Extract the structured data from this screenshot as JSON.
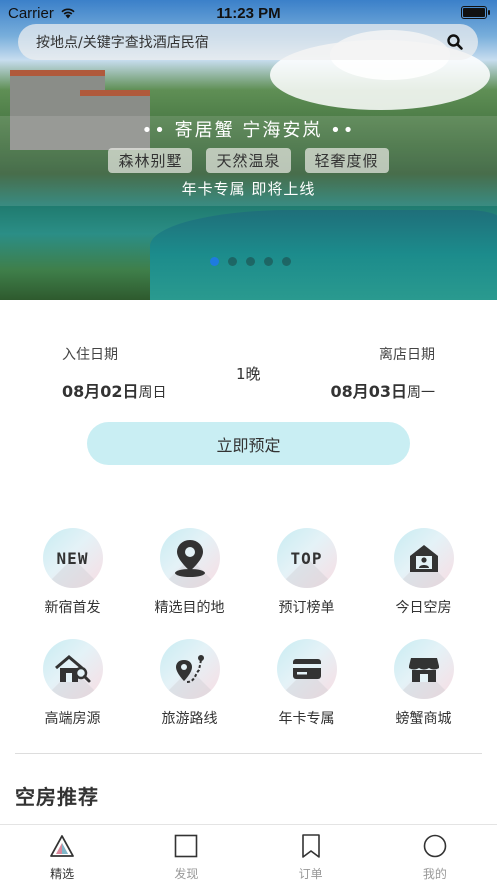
{
  "status_bar": {
    "carrier": "Carrier",
    "time": "11:23 PM"
  },
  "search": {
    "placeholder": "按地点/关键字查找酒店民宿",
    "icon": "search-icon"
  },
  "banner": {
    "title": "•• 寄居蟹 宁海安岚 ••",
    "tags": [
      "森林别墅",
      "天然温泉",
      "轻奢度假"
    ],
    "subtitle": "年卡专属  即将上线",
    "slide_count": 5,
    "active_slide": 0
  },
  "booking": {
    "checkin_label": "入住日期",
    "checkin_date": "08月02日",
    "checkin_weekday": "周日",
    "nights": "1晚",
    "checkout_label": "离店日期",
    "checkout_date": "08月03日",
    "checkout_weekday": "周一",
    "book_button": "立即预定",
    "button_color": "#c9eef3"
  },
  "categories": [
    {
      "label": "新宿首发",
      "icon": "new-badge-icon",
      "icon_text": "NEW"
    },
    {
      "label": "精选目的地",
      "icon": "location-pin-icon"
    },
    {
      "label": "预订榜单",
      "icon": "top-badge-icon",
      "icon_text": "TOP"
    },
    {
      "label": "今日空房",
      "icon": "house-user-icon"
    },
    {
      "label": "高端房源",
      "icon": "house-search-icon"
    },
    {
      "label": "旅游路线",
      "icon": "route-map-icon"
    },
    {
      "label": "年卡专属",
      "icon": "card-icon"
    },
    {
      "label": "螃蟹商城",
      "icon": "store-icon"
    }
  ],
  "section": {
    "title": "空房推荐"
  },
  "tabbar": {
    "items": [
      {
        "label": "精选",
        "icon": "triangle-icon",
        "active": true
      },
      {
        "label": "发现",
        "icon": "square-icon",
        "active": false
      },
      {
        "label": "订单",
        "icon": "bookmark-icon",
        "active": false
      },
      {
        "label": "我的",
        "icon": "circle-icon",
        "active": false
      }
    ]
  }
}
